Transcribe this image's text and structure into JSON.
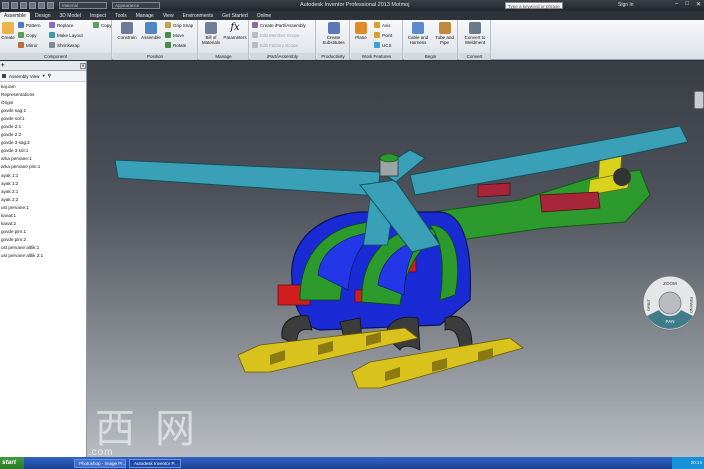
{
  "titlebar": {
    "title": "Autodesk Inventor Professional 2013   Motmoj",
    "combo_material": "Material",
    "combo_appearance": "Appearance",
    "search_placeholder": "Type a keyword or phrase",
    "signin": "Sign In"
  },
  "tabs": [
    "Assemble",
    "Design",
    "3D Model",
    "Inspect",
    "Tools",
    "Manage",
    "View",
    "Environments",
    "Get Started",
    "Online"
  ],
  "ribbon": {
    "component": {
      "title": "Component",
      "insert": "Create",
      "place_label": "Pattern",
      "copy": "Copy",
      "mirror": "Mirror",
      "replace": "Replace",
      "make_layout": "Make Layout",
      "shrinkwrap": "Shrinkwrap",
      "copy2": "Copy"
    },
    "position": {
      "title": "Position",
      "constrain": "Constrain",
      "assemble": "Assemble",
      "grip_snap": "Grip Snap",
      "move": "Move",
      "rotate": "Rotate"
    },
    "manage": {
      "title": "Manage",
      "bom": "Bill of\nMaterials",
      "params": "Parameters"
    },
    "ipart": {
      "title": "iPart/iAssembly",
      "create": "Create iPart/iAssembly",
      "edit_member": "Edit Member Scope",
      "edit_factory": "Edit Factory Scope"
    },
    "productivity": {
      "title": "Productivity",
      "create_sub": "Create\nSubstitutes"
    },
    "work": {
      "title": "Work Features",
      "plane": "Plane",
      "axis": "Axis",
      "point": "Point",
      "ucs": "UCS"
    },
    "begin": {
      "title": "Begin",
      "cable": "Cable and\nHarness",
      "tube": "Tube and\nPipe"
    },
    "convert": {
      "title": "Convert",
      "convert": "Convert to\nWeldment"
    }
  },
  "browser": {
    "tab_label": "Assembly View",
    "items": [
      "kaj.iam",
      "Representations",
      "Origin",
      "govde sag:1",
      "govde sol:1",
      "govde 2:1",
      "govde 2:2",
      "govde 3 sag:2",
      "govde 3 sol:1",
      "arka pervane:1",
      "arka pervane pim:1",
      "ayak 1:1",
      "ayak 1:2",
      "ayak 2:1",
      "ayak 2:2",
      "ust pervane:1",
      "kanat:1",
      "kanat:2",
      "govde pim:1",
      "govde pim:2",
      "ust pervane altlik:1",
      "ust pervane altlik 2:1"
    ]
  },
  "viewport": {
    "navwheel_labels": {
      "zoom": "ZOOM",
      "orbit": "ORBIT",
      "pan": "PAN",
      "rewind": "REWIND"
    },
    "watermark": "莫西网",
    "watermark_url": "www.3dmox.com"
  },
  "taskbar": {
    "start": "start",
    "tasks": [
      "Photoshop - Image Pr...",
      "Autodesk Inventor P..."
    ],
    "clock": "20:14"
  },
  "colors": {
    "heli_body": "#1a2bd6",
    "heli_red": "#d01e1e",
    "heli_green": "#2c9a2c",
    "heli_blades": "#3aa0b8",
    "heli_skids": "#d9c21c",
    "heli_legs": "#3c3c3c"
  }
}
